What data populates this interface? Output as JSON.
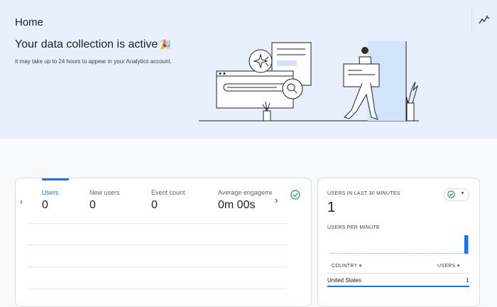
{
  "header": {
    "title": "Home"
  },
  "hero": {
    "heading": "Your data collection is active",
    "emoji": "🎉",
    "subtext": "It may take up to 24 hours to appear in your Analytics account."
  },
  "overview": {
    "tabs": [
      {
        "label": "Users",
        "value": "0"
      },
      {
        "label": "New users",
        "value": "0"
      },
      {
        "label": "Event count",
        "value": "0"
      },
      {
        "label": "Average engageme",
        "value": "0m 00s"
      }
    ],
    "prev_arrow": "‹",
    "next_arrow": "›"
  },
  "realtime": {
    "title": "USERS IN LAST 30 MINUTES",
    "count": "1",
    "subtitle": "USERS PER MINUTE",
    "table": {
      "headers": [
        "COUNTRY ▾",
        "USERS ▾"
      ],
      "rows": [
        {
          "country": "United States",
          "users": "1"
        }
      ]
    },
    "per_minute": [
      0,
      0,
      0,
      0,
      0,
      0,
      0,
      0,
      0,
      0,
      0,
      0,
      0,
      0,
      0,
      0,
      0,
      0,
      0,
      0,
      0,
      0,
      0,
      0,
      0,
      0,
      0,
      0,
      0,
      1
    ]
  },
  "colors": {
    "accent": "#1a73e8",
    "success": "#1e8e3e",
    "hero_bg": "#e8f0fe"
  },
  "icons": {
    "insights": "insights-sparkline-icon",
    "status": "check-circle-icon"
  }
}
